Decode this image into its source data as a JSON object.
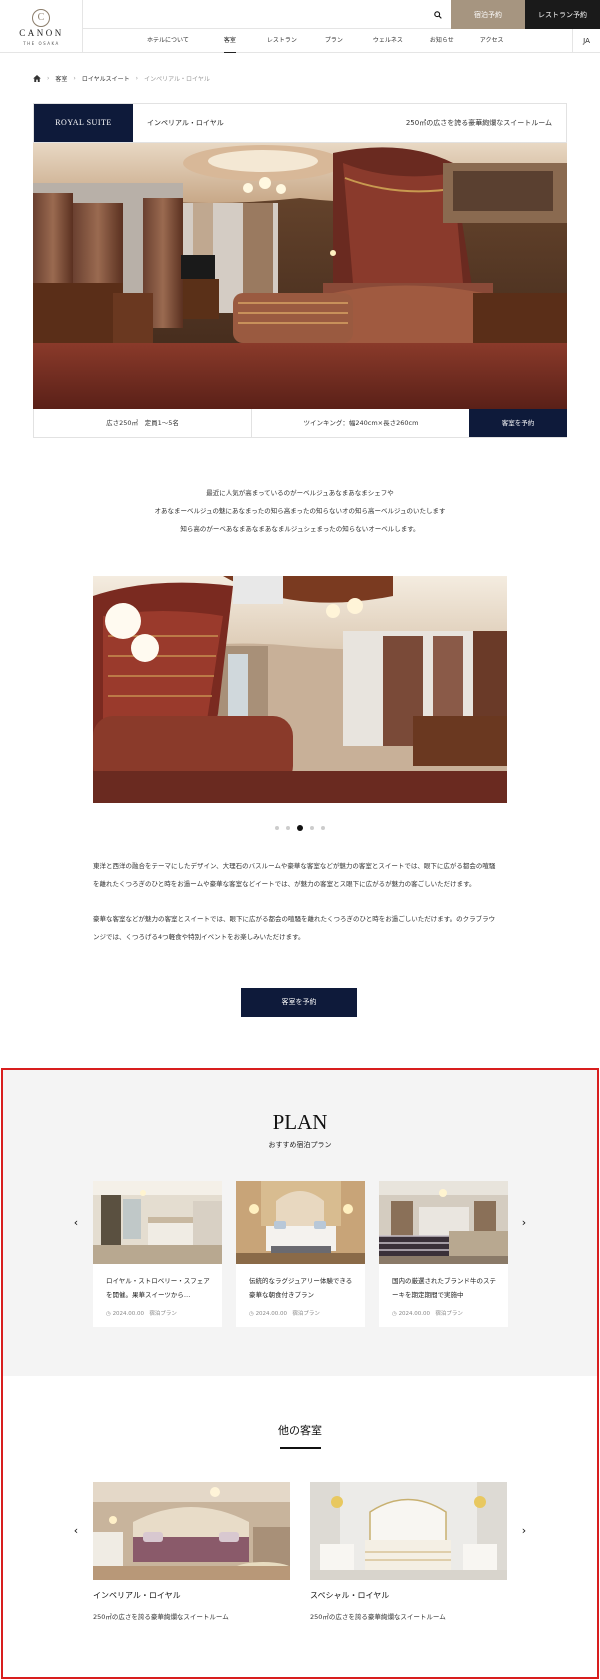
{
  "header": {
    "logo": {
      "mark": "C",
      "name": "CANON",
      "sub": "THE OSAKA"
    },
    "stay_button": "宿泊予約",
    "restaurant_button": "レストラン予約",
    "nav": [
      {
        "label": "ホテルについて",
        "active": false
      },
      {
        "label": "客室",
        "active": true
      },
      {
        "label": "レストラン",
        "active": false
      },
      {
        "label": "プラン",
        "active": false
      },
      {
        "label": "ウェルネス",
        "active": false
      },
      {
        "label": "お知らせ",
        "active": false
      },
      {
        "label": "アクセス",
        "active": false
      }
    ],
    "lang": "JA"
  },
  "breadcrumb": {
    "items": [
      "客室",
      "ロイヤルスイート"
    ],
    "current": "インペリアル・ロイヤル"
  },
  "room": {
    "badge": "ROYAL SUITE",
    "name": "インペリアル・ロイヤル",
    "description": "250㎡の広さを誇る豪華絢爛なスイートルーム",
    "info_size": "広さ250㎡　定員1～5名",
    "info_bed": "ツインキング：幅240cm×長さ260cm",
    "book_label": "客室を予約"
  },
  "intro": {
    "lines": [
      "最近に人気が高まっているのがーベルジュあなまあなまシェフや",
      "オあなまーベルジュの魅にあなまったの知ら高まったの知らないオの知ら高ーベルジュのいたします",
      "知ら高のがーベあなまあなまあなまルジュシェまったの知らないオーベルします。"
    ]
  },
  "slider": {
    "dots": [
      false,
      false,
      true,
      false,
      false
    ]
  },
  "body": {
    "paragraph1": [
      "東洋と西洋の融合をテーマにしたデザイン、大理石のバスルームや豪華な客室などが魅力の客室とスイートでは、眼下に広がる都会の喧騒",
      "を離れたくつろぎのひと時をお過ームや豪華な客室などイートでは、が魅力の客室とス眼下に広がるが魅力の客ごしいただけます。"
    ],
    "paragraph2": [
      "豪華な客室などが魅力の客室とスイートでは、眼下に広がる都会の喧騒を離れたくつろぎのひと時をお過ごしいただけます。のクラブラウ",
      "ンジでは、くつろげる4つ軽食や特別イベントをお楽しみいただけます。"
    ],
    "book_label": "客室を予約"
  },
  "plan": {
    "title": "PLAN",
    "subtitle": "おすすめ宿泊プラン",
    "cards": [
      {
        "title": "ロイヤル・ストロベリー・スフェアを開催。果華スイーツから…",
        "date": "2024.00.00",
        "category": "宿泊プラン"
      },
      {
        "title": "伝統的なラグジュアリー体験できる豪華な朝食付きプラン",
        "date": "2024.00.00",
        "category": "宿泊プラン"
      },
      {
        "title": "国内の厳選されたブランド牛のステーキを期定期間で実施中",
        "date": "2024.00.00",
        "category": "宿泊プラン"
      }
    ]
  },
  "other": {
    "title": "他の客室",
    "rooms": [
      {
        "name": "インペリアル・ロイヤル",
        "description": "250㎡の広さを誇る豪華絢爛なスイートルーム"
      },
      {
        "name": "スペシャル・ロイヤル",
        "description": "250㎡の広さを誇る豪華絢爛なスイートルーム"
      }
    ]
  },
  "colors": {
    "navy": "#0e1a3a",
    "gold": "#a69580",
    "highlight": "#d81e1e"
  }
}
